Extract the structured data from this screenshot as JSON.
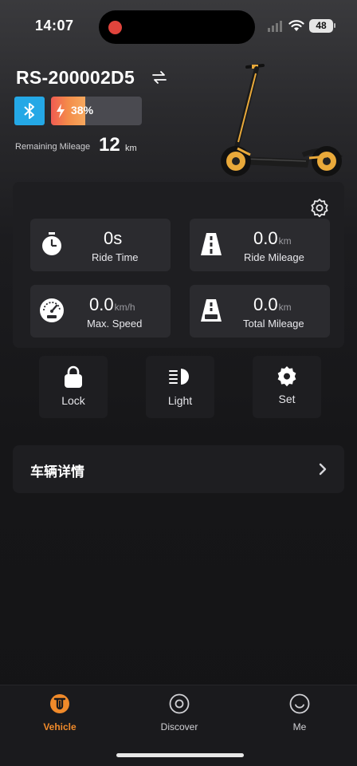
{
  "status_bar": {
    "time": "14:07",
    "battery": "48"
  },
  "device": {
    "name": "RS-200002D5",
    "swap_icon": "swap-arrows-icon",
    "bluetooth_icon": "bluetooth-icon",
    "battery_percent": "38%",
    "battery_level": 0.38,
    "remaining_mileage_label": "Remaining Mileage",
    "remaining_mileage_value": "12",
    "remaining_mileage_unit": "km"
  },
  "stats": {
    "settings_icon": "gear-outline-icon",
    "ride_time": {
      "value": "0s",
      "unit": "",
      "label": "Ride Time",
      "icon": "stopwatch-icon"
    },
    "ride_mileage": {
      "value": "0.0",
      "unit": "km",
      "label": "Ride Mileage",
      "icon": "road-icon"
    },
    "max_speed": {
      "value": "0.0",
      "unit": "km/h",
      "label": "Max. Speed",
      "icon": "speedometer-icon"
    },
    "total_mileage": {
      "value": "0.0",
      "unit": "km",
      "label": "Total Mileage",
      "icon": "odometer-road-icon"
    }
  },
  "controls": {
    "lock": "Lock",
    "light": "Light",
    "set": "Set"
  },
  "details": {
    "label": "车辆详情"
  },
  "tabs": [
    {
      "label": "Vehicle",
      "icon": "scooter-logo-icon",
      "active": true
    },
    {
      "label": "Discover",
      "icon": "compass-circle-icon",
      "active": false
    },
    {
      "label": "Me",
      "icon": "smiley-icon",
      "active": false
    }
  ],
  "colors": {
    "accent": "#f08a2a",
    "bluetooth": "#24a8e6",
    "battery_start": "#f05b52",
    "battery_end": "#f6a85e",
    "status_red": "#e0443c"
  }
}
